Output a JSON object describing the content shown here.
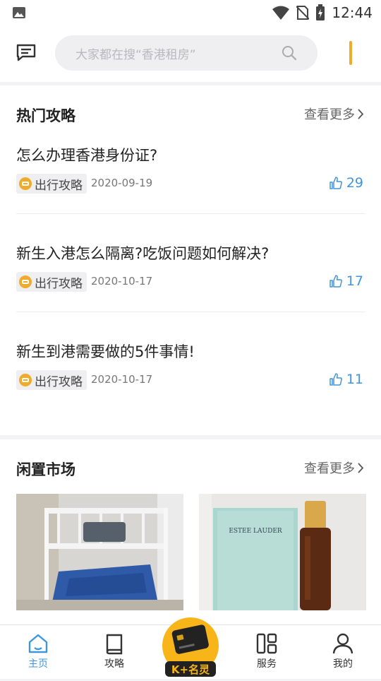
{
  "status_bar": {
    "time": "12:44"
  },
  "header": {
    "search_placeholder": "大家都在搜“香港租房”"
  },
  "hot_guides": {
    "title": "热门攻略",
    "more": "查看更多",
    "articles": [
      {
        "title": "怎么办理香港身份证?",
        "tag": "出行攻略",
        "date": "2020-09-19",
        "likes": "29"
      },
      {
        "title": "新生入港怎么隔离?吃饭问题如何解决?",
        "tag": "出行攻略",
        "date": "2020-10-17",
        "likes": "17"
      },
      {
        "title": "新生到港需要做的5件事情!",
        "tag": "出行攻略",
        "date": "2020-10-17",
        "likes": "11"
      }
    ]
  },
  "market": {
    "title": "闲置市场",
    "more": "查看更多",
    "items": [
      {
        "image": "bunk-bed-photo"
      },
      {
        "image": "estee-lauder-serum-photo",
        "brand_text": "ESTEE LAUDER"
      }
    ]
  },
  "tabbar": {
    "tabs": [
      {
        "label": "主页",
        "icon": "home-icon",
        "active": true
      },
      {
        "label": "攻略",
        "icon": "book-icon"
      },
      {
        "label": "服务",
        "icon": "grid-icon"
      },
      {
        "label": "我的",
        "icon": "person-icon"
      }
    ],
    "center_badge": "K+名灵"
  },
  "colors": {
    "accent": "#3f96dc",
    "orange": "#f0ab2b",
    "tag_bg": "#efeff1"
  }
}
